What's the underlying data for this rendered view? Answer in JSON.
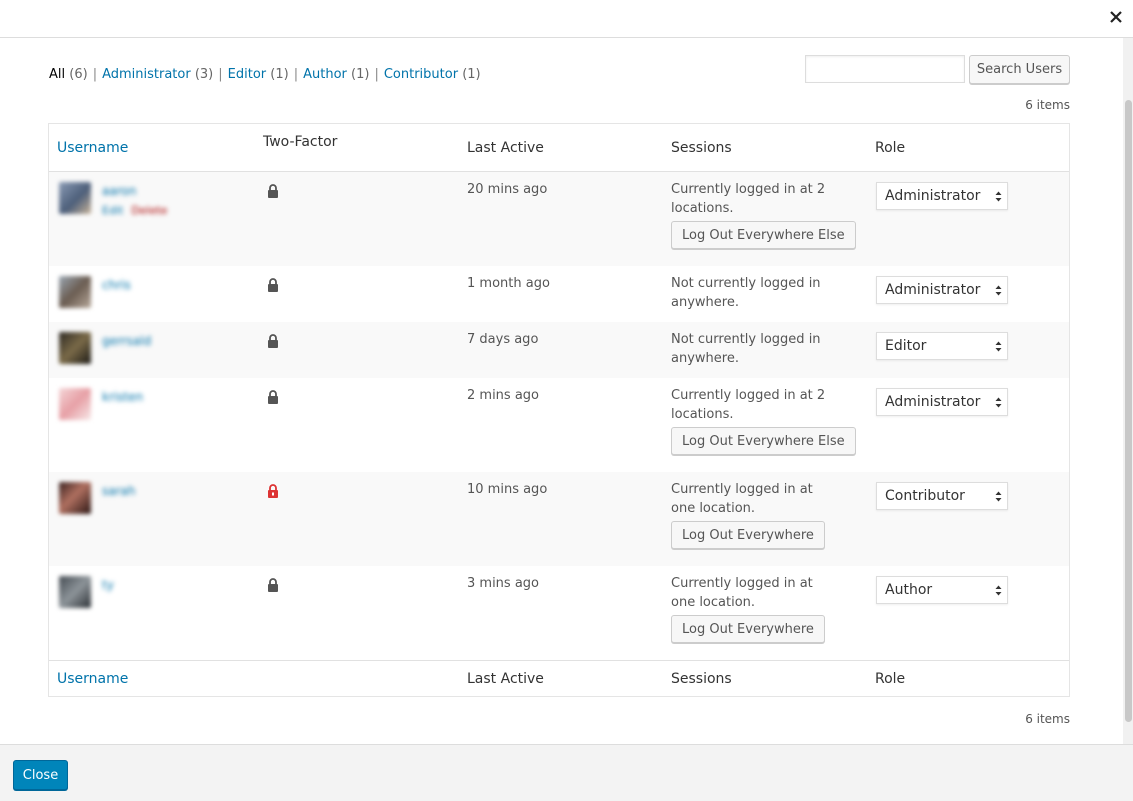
{
  "window": {
    "close_icon": "close-icon"
  },
  "filters": [
    {
      "label": "All",
      "count": "(6)",
      "current": true
    },
    {
      "label": "Administrator",
      "count": "(3)",
      "current": false
    },
    {
      "label": "Editor",
      "count": "(1)",
      "current": false
    },
    {
      "label": "Author",
      "count": "(1)",
      "current": false
    },
    {
      "label": "Contributor",
      "count": "(1)",
      "current": false
    }
  ],
  "search": {
    "value": "",
    "button_label": "Search Users"
  },
  "items_count_top": "6 items",
  "items_count_bottom": "6 items",
  "columns": {
    "username": "Username",
    "two_factor": "Two-Factor",
    "last_active": "Last Active",
    "sessions": "Sessions",
    "role": "Role"
  },
  "users": [
    {
      "username": "aaron",
      "actions": {
        "edit": "Edit",
        "delete": "Delete"
      },
      "two_factor": "lock-icon",
      "lock_color": "#555555",
      "last_active": "20 mins ago",
      "sessions": "Currently logged in at 2 locations.",
      "session_button": "Log Out Everywhere Else",
      "role": "Administrator"
    },
    {
      "username": "chris",
      "two_factor": "lock-icon",
      "lock_color": "#555555",
      "last_active": "1 month ago",
      "sessions": "Not currently logged in anywhere.",
      "session_button": "",
      "role": "Administrator"
    },
    {
      "username": "gerrsald",
      "two_factor": "lock-icon",
      "lock_color": "#555555",
      "last_active": "7 days ago",
      "sessions": "Not currently logged in anywhere.",
      "session_button": "",
      "role": "Editor"
    },
    {
      "username": "kristen",
      "two_factor": "lock-icon",
      "lock_color": "#555555",
      "last_active": "2 mins ago",
      "sessions": "Currently logged in at 2 locations.",
      "session_button": "Log Out Everywhere Else",
      "role": "Administrator"
    },
    {
      "username": "sarah",
      "two_factor": "lock-icon",
      "lock_color": "#dd3333",
      "last_active": "10 mins ago",
      "sessions": "Currently logged in at one location.",
      "session_button": "Log Out Everywhere",
      "role": "Contributor"
    },
    {
      "username": "ty",
      "two_factor": "lock-icon",
      "lock_color": "#555555",
      "last_active": "3 mins ago",
      "sessions": "Currently logged in at one location.",
      "session_button": "Log Out Everywhere",
      "role": "Author"
    }
  ],
  "footer": {
    "close_label": "Close"
  },
  "colors": {
    "link": "#0073aa",
    "primary_button": "#0085ba",
    "delete": "#aa0000",
    "lock_warning": "#dd3333"
  }
}
